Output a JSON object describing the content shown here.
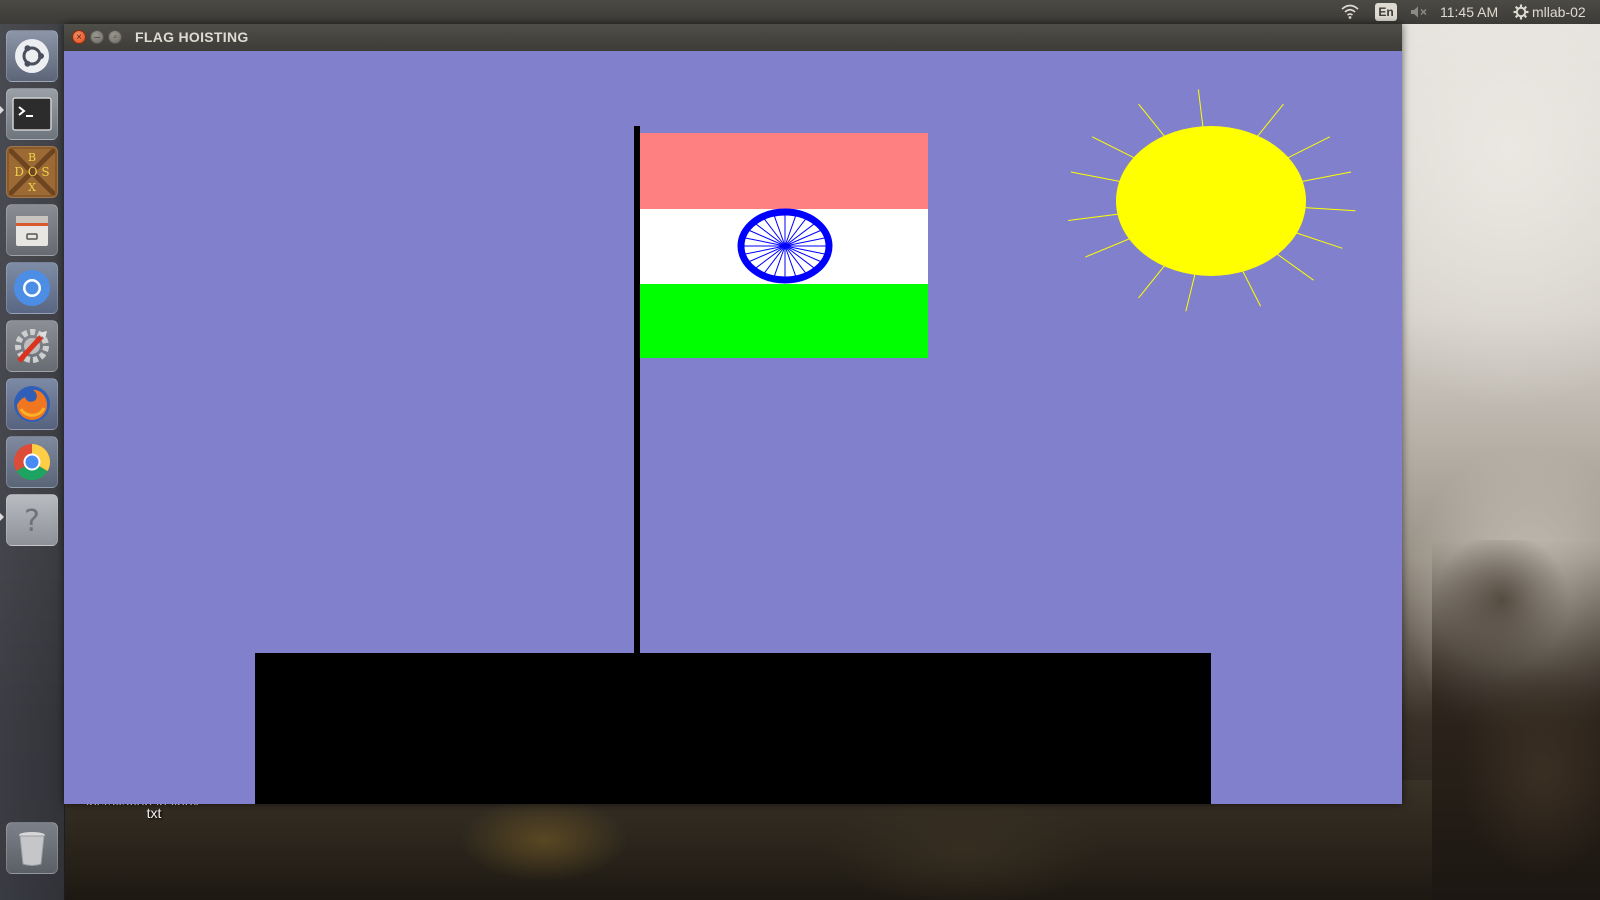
{
  "top_panel": {
    "language": "En",
    "clock": "11:45 AM",
    "username": "mllab-02"
  },
  "window": {
    "title": "FLAG HOISTING"
  },
  "desktop": {
    "file_label_line1": "installation in linux.",
    "file_label_line2": "txt"
  },
  "launcher": {
    "items": [
      "ubuntu-dash",
      "terminal",
      "dosbox",
      "files",
      "chromium",
      "system-settings",
      "firefox",
      "google-chrome",
      "help",
      "trash"
    ]
  },
  "scene": {
    "background_color": "#8080cc",
    "flag_colors": {
      "top": "#ff8080",
      "middle": "#ffffff",
      "bottom": "#00ff00",
      "chakra": "#0000ff"
    },
    "sun_color": "#ffff00",
    "pole_color": "#000000",
    "base_color": "#000000"
  }
}
